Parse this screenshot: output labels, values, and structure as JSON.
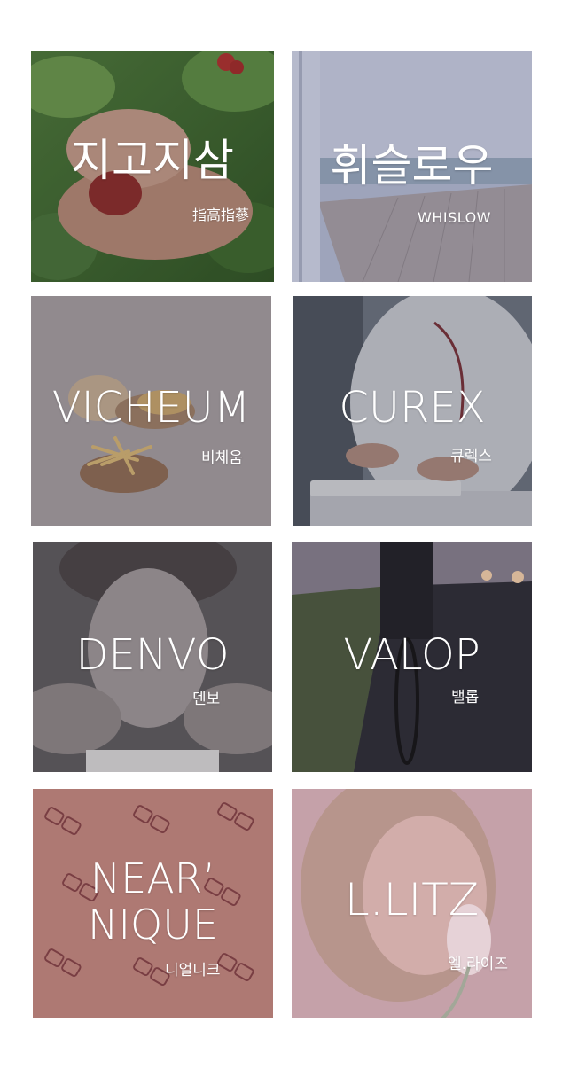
{
  "brands": [
    {
      "id": "jigojisam",
      "title": "지고지삼",
      "subtitle": "指高指蔘",
      "image": "hands-holding-ginseng-berries-photo"
    },
    {
      "id": "whislow",
      "title": "휘슬로우",
      "subtitle": "WHISLOW",
      "image": "seaside-terrace-photo"
    },
    {
      "id": "vicheum",
      "title": "VICHEUM",
      "subtitle": "비체움",
      "image": "burger-and-fries-photo"
    },
    {
      "id": "curex",
      "title": "CUREX",
      "subtitle": "큐렉스",
      "image": "doctor-typing-keyboard-photo"
    },
    {
      "id": "denvo",
      "title": "DENVO",
      "subtitle": "덴보",
      "image": "young-man-portrait-photo"
    },
    {
      "id": "valop",
      "title": "VALOP",
      "subtitle": "밸롭",
      "image": "cyclist-on-road-photo"
    },
    {
      "id": "nearnique",
      "title_line1": "NEAR’",
      "title_line2": "NIQUE",
      "subtitle": "니얼니크",
      "image": "glasses-pattern-photo"
    },
    {
      "id": "llitz",
      "title": "L.LITZ",
      "subtitle": "엘.라이즈",
      "image": "woman-with-flower-photo"
    }
  ]
}
